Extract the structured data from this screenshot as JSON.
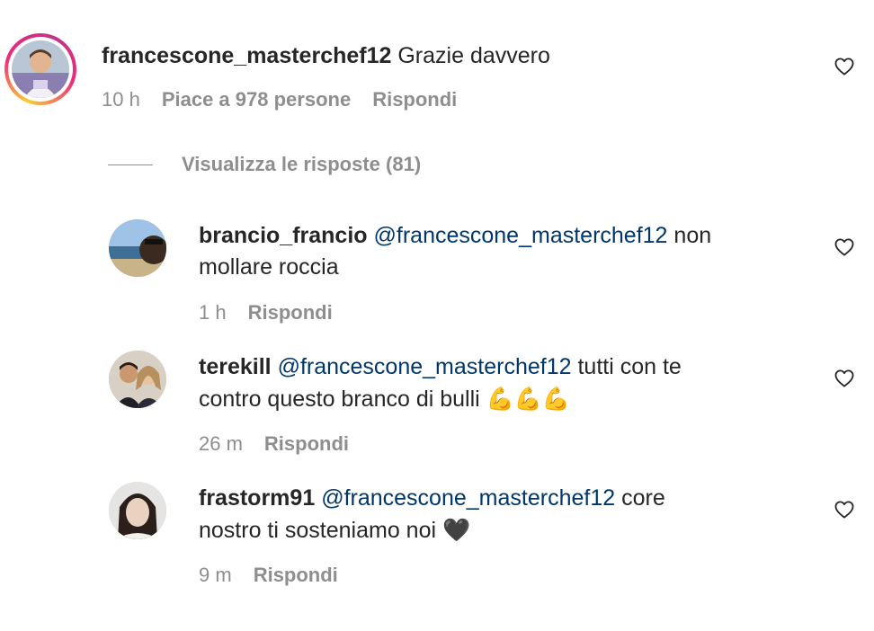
{
  "main_comment": {
    "username": "francescone_masterchef12",
    "text": "Grazie davvero",
    "time": "10 h",
    "likes": "Piace a 978 persone",
    "reply_label": "Rispondi"
  },
  "replies_toggle": {
    "label": "Visualizza le risposte (81)"
  },
  "replies": [
    {
      "username": "brancio_francio",
      "mention": "@francescone_masterchef12",
      "text_line1": "non",
      "text_line2": "mollare roccia",
      "time": "1 h",
      "reply_label": "Rispondi"
    },
    {
      "username": "terekill",
      "mention": "@francescone_masterchef12",
      "text_line1": "tutti con te",
      "text_line2": "contro questo branco di bulli",
      "emoji": "💪💪💪",
      "time": "26 m",
      "reply_label": "Rispondi"
    },
    {
      "username": "frastorm91",
      "mention": "@francescone_masterchef12",
      "text_line1": "core",
      "text_line2": "nostro ti sosteniamo noi",
      "emoji": "🖤",
      "time": "9 m",
      "reply_label": "Rispondi"
    }
  ],
  "colors": {
    "text": "#262626",
    "secondary": "#8e8e8e",
    "mention": "#00376b"
  },
  "icons": {
    "like": "heart-outline-icon"
  }
}
